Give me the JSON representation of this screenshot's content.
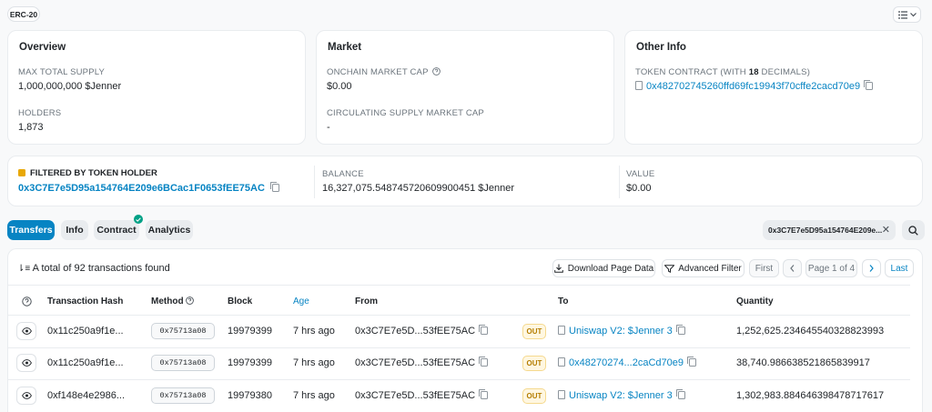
{
  "header": {
    "token_standard": "ERC-20"
  },
  "overview": {
    "title": "Overview",
    "max_supply_label": "MAX TOTAL SUPPLY",
    "max_supply_value": "1,000,000,000 $Jenner",
    "holders_label": "HOLDERS",
    "holders_value": "1,873"
  },
  "market": {
    "title": "Market",
    "onchain_cap_label": "ONCHAIN MARKET CAP",
    "onchain_cap_value": "$0.00",
    "circ_cap_label": "CIRCULATING SUPPLY MARKET CAP",
    "circ_cap_value": "-"
  },
  "other_info": {
    "title": "Other Info",
    "contract_label_pre": "TOKEN CONTRACT (WITH ",
    "contract_decimals": "18",
    "contract_label_post": " DECIMALS)",
    "contract_address": "0x482702745260ffd69fc19943f70cffe2cacd70e9"
  },
  "filter": {
    "label": "FILTERED BY TOKEN HOLDER",
    "address": "0x3C7E7e5D95a154764E209e6BCac1F0653fEE75AC",
    "balance_label": "BALANCE",
    "balance_value": "16,327,075.548745720609900451 $Jenner",
    "value_label": "VALUE",
    "value_value": "$0.00"
  },
  "tabs": [
    {
      "label": "Transfers"
    },
    {
      "label": "Info"
    },
    {
      "label": "Contract"
    },
    {
      "label": "Analytics"
    }
  ],
  "search_filter": {
    "value": "0x3C7E7e5D95a154764E209e..."
  },
  "toolbar": {
    "total_text": "A total of 92 transactions found",
    "download_label": "Download Page Data",
    "advanced_filter_label": "Advanced Filter",
    "first_label": "First",
    "page_label": "Page 1 of 4",
    "last_label": "Last"
  },
  "table": {
    "headers": {
      "tx_hash": "Transaction Hash",
      "method": "Method",
      "block": "Block",
      "age": "Age",
      "from": "From",
      "to": "To",
      "quantity": "Quantity"
    },
    "rows": [
      {
        "hash": "0x11c250a9f1e...",
        "method": "0x75713a08",
        "block": "19979399",
        "age": "7 hrs ago",
        "from": "0x3C7E7e5D...53fEE75AC",
        "direction": "OUT",
        "to": "Uniswap V2: $Jenner 3",
        "quantity": "1,252,625.234645540328823993"
      },
      {
        "hash": "0x11c250a9f1e...",
        "method": "0x75713a08",
        "block": "19979399",
        "age": "7 hrs ago",
        "from": "0x3C7E7e5D...53fEE75AC",
        "direction": "OUT",
        "to": "0x48270274...2caCd70e9",
        "quantity": "38,740.986638521865839917"
      },
      {
        "hash": "0xf148e4e2986...",
        "method": "0x75713a08",
        "block": "19979380",
        "age": "7 hrs ago",
        "from": "0x3C7E7e5D...53fEE75AC",
        "direction": "OUT",
        "to": "Uniswap V2: $Jenner 3",
        "quantity": "1,302,983.884646398478717617"
      }
    ]
  },
  "colors": {
    "link": "#0784c3",
    "accent": "#0784c3",
    "out_badge": "#b47d00",
    "verified": "#00a186"
  }
}
